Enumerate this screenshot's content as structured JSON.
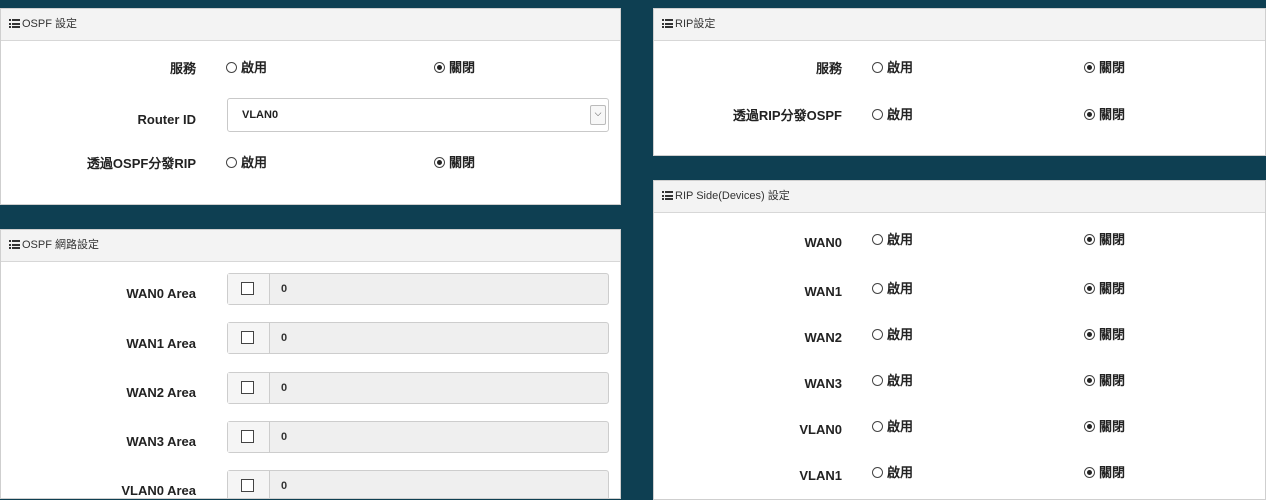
{
  "radio_labels": {
    "enable": "啟用",
    "disable": "關閉"
  },
  "ospf": {
    "title": "OSPF 設定",
    "service_label": "服務",
    "router_id_label": "Router ID",
    "router_id_value": "VLAN0",
    "redistribute_label": "透過OSPF分發RIP"
  },
  "ospf_network": {
    "title": "OSPF 網路設定",
    "rows": [
      {
        "label": "WAN0 Area",
        "value": "0"
      },
      {
        "label": "WAN1 Area",
        "value": "0"
      },
      {
        "label": "WAN2 Area",
        "value": "0"
      },
      {
        "label": "WAN3 Area",
        "value": "0"
      },
      {
        "label": "VLAN0 Area",
        "value": "0"
      }
    ]
  },
  "rip": {
    "title": "RIP設定",
    "service_label": "服務",
    "redistribute_label": "透過RIP分發OSPF"
  },
  "rip_side": {
    "title": "RIP Side(Devices) 設定",
    "rows": [
      {
        "label": "WAN0"
      },
      {
        "label": "WAN1"
      },
      {
        "label": "WAN2"
      },
      {
        "label": "WAN3"
      },
      {
        "label": "VLAN0"
      },
      {
        "label": "VLAN1"
      }
    ]
  },
  "selected": "disable"
}
